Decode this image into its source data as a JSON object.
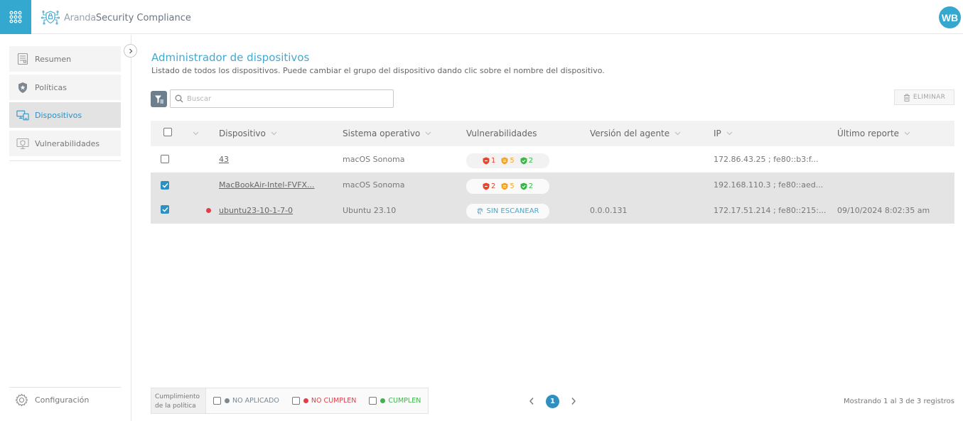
{
  "app": {
    "brand_prefix": "Aranda",
    "brand_product": "Security Compliance",
    "user_initials": "WB",
    "accent_color": "#35a8d0"
  },
  "sidebar": {
    "items": [
      {
        "label": "Resumen",
        "icon": "report-icon"
      },
      {
        "label": "Políticas",
        "icon": "shield-star-icon"
      },
      {
        "label": "Dispositivos",
        "icon": "devices-icon",
        "active": true
      },
      {
        "label": "Vulnerabilidades",
        "icon": "monitor-shield-icon"
      }
    ],
    "config_label": "Configuración"
  },
  "main": {
    "title": "Administrador de dispositivos",
    "subtitle": "Listado de todos los dispositivos. Puede cambiar el grupo del dispositivo dando clic sobre el nombre del dispositivo.",
    "search_placeholder": "Buscar",
    "delete_label": "ELIMINAR"
  },
  "table": {
    "columns": [
      "Dispositivo",
      "Sistema operativo",
      "Vulnerabilidades",
      "Versión del agente",
      "IP",
      "Último reporte"
    ],
    "rows": [
      {
        "checked": false,
        "alert": false,
        "device": "43",
        "os": "macOS Sonoma",
        "vuln": {
          "high": "1",
          "medium": "5",
          "low": "2"
        },
        "agent": "",
        "ip": "172.86.43.25 ; fe80::b3:f...",
        "last_report": ""
      },
      {
        "checked": true,
        "alert": false,
        "device": "MacBookAir-Intel-FVFX...",
        "os": "macOS Sonoma",
        "vuln": {
          "high": "2",
          "medium": "5",
          "low": "2"
        },
        "agent": "",
        "ip": "192.168.110.3 ; fe80::aed...",
        "last_report": ""
      },
      {
        "checked": true,
        "alert": true,
        "device": "ubuntu23-10-1-7-0",
        "os": "Ubuntu 23.10",
        "scan_label": "SIN ESCANEAR",
        "agent": "0.0.0.131",
        "ip": "172.17.51.214 ; fe80::215:...",
        "last_report": "09/10/2024 8:02:35 am"
      }
    ]
  },
  "legend": {
    "title_line1": "Cumplimiento",
    "title_line2": "de la política",
    "items": [
      {
        "label": "NO APLICADO",
        "color": "#7a8893"
      },
      {
        "label": "NO CUMPLEN",
        "color": "#e23d4a"
      },
      {
        "label": "CUMPLEN",
        "color": "#3bb54a"
      }
    ]
  },
  "pagination": {
    "current_page": "1",
    "summary": "Mostrando 1 al 3 de 3 registros"
  },
  "colors": {
    "vuln_high": "#e8452c",
    "vuln_medium": "#f2a430",
    "vuln_low": "#3bb54a"
  }
}
